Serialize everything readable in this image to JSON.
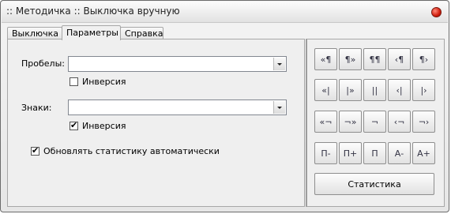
{
  "window": {
    "title": ":: Методичка :: Выключка вручную"
  },
  "tabs": [
    {
      "label": "Выключка"
    },
    {
      "label": "Параметры"
    },
    {
      "label": "Справка"
    }
  ],
  "params": {
    "spaces_label": "Пробелы:",
    "spaces_value": "",
    "spaces_inversion_label": "Инверсия",
    "spaces_inversion_checked": false,
    "chars_label": "Знаки:",
    "chars_value": "",
    "chars_inversion_label": "Инверсия",
    "chars_inversion_checked": true,
    "auto_stats_label": "Обновлять статистику автоматически",
    "auto_stats_checked": true
  },
  "buttons": {
    "row1": [
      "«¶",
      "¶»",
      "¶¶",
      "‹¶",
      "¶›"
    ],
    "row2": [
      "«|",
      "|»",
      "||",
      "‹|",
      "|›"
    ],
    "row3": [
      "«¬",
      "¬»",
      "¬",
      "‹¬",
      "¬›"
    ],
    "row4": [
      "П-",
      "П+",
      "П",
      "А-",
      "А+"
    ],
    "statistics": "Статистика"
  }
}
